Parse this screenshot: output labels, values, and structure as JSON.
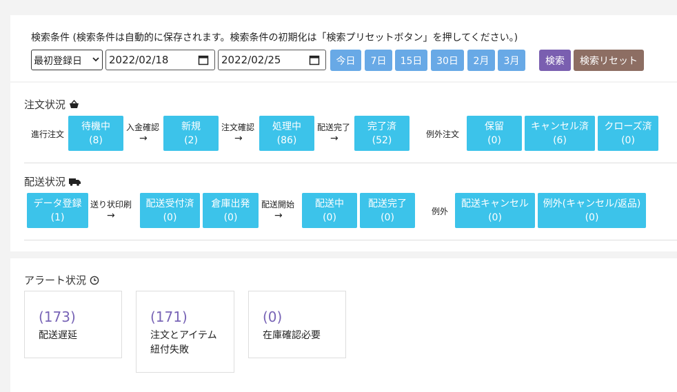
{
  "search": {
    "title": "検索条件 (検索条件は自動的に保存されます。検索条件の初期化は「検索プリセットボタン」を押してください。)",
    "date_type": "最初登録日",
    "date_from": "2022/02/18",
    "date_to": "2022/02/25",
    "quick": [
      "今日",
      "7日",
      "15日",
      "30日",
      "2月",
      "3月"
    ],
    "search_label": "検索",
    "reset_label": "検索リセット"
  },
  "order_status": {
    "title": "注文状況",
    "icon": "basket-icon",
    "progress_label": "進行注文",
    "exception_label": "例外注文",
    "steps": [
      "入金確認",
      "注文確認",
      "配送完了"
    ],
    "arrow": "→",
    "boxes": [
      {
        "label": "待機中",
        "count": "(8)"
      },
      {
        "label": "新規",
        "count": "(2)"
      },
      {
        "label": "処理中",
        "count": "(86)"
      },
      {
        "label": "完了済",
        "count": "(52)"
      }
    ],
    "exceptions": [
      {
        "label": "保留",
        "count": "(0)"
      },
      {
        "label": "キャンセル済",
        "count": "(6)"
      },
      {
        "label": "クローズ済",
        "count": "(0)"
      }
    ]
  },
  "shipping_status": {
    "title": "配送状況",
    "icon": "truck-icon",
    "exception_label": "例外",
    "steps": [
      "送り状印刷",
      "配送開始"
    ],
    "boxes": [
      {
        "label": "データ登録",
        "count": "(1)"
      },
      {
        "label": "配送受付済",
        "count": "(0)"
      },
      {
        "label": "倉庫出発",
        "count": "(0)"
      },
      {
        "label": "配送中",
        "count": "(0)"
      },
      {
        "label": "配送完了",
        "count": "(0)"
      }
    ],
    "exceptions": [
      {
        "label": "配送キャンセル",
        "count": "(0)"
      },
      {
        "label": "例外(キャンセル/返品)",
        "count": "(0)"
      }
    ]
  },
  "alert_status": {
    "title": "アラート状況",
    "icon": "clock-icon",
    "cards": [
      {
        "count": "(173)",
        "label": "配送遅延"
      },
      {
        "count": "(171)",
        "label": "注文とアイテム紐付失敗"
      },
      {
        "count": "(0)",
        "label": "在庫確認必要"
      }
    ]
  },
  "colors": {
    "box": "#3cc3ea",
    "quick_button": "#68a9e6",
    "search_button": "#7a5fb0",
    "reset_button": "#8d6e63",
    "alert_count": "#7864b6"
  }
}
